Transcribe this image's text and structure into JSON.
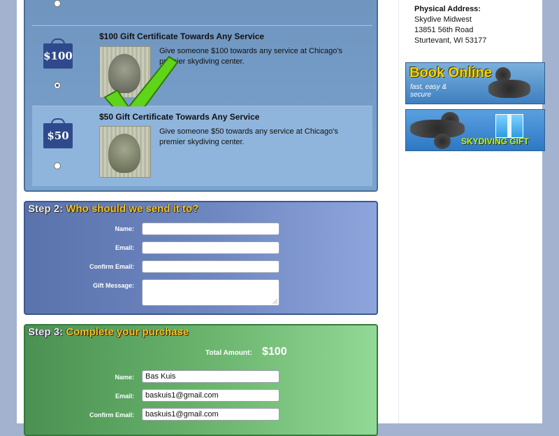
{
  "gifts": [
    {
      "price_tag": "$100",
      "title": "$100 Gift Certificate Towards Any Service",
      "description": "Give someone $100 towards any service at Chicago's premier skydiving center.",
      "selected": true
    },
    {
      "price_tag": "$50",
      "title": "$50 Gift Certificate Towards Any Service",
      "description": "Give someone $50 towards any service at Chicago's premier skydiving center.",
      "selected": false
    }
  ],
  "step2": {
    "number": "Step 2:",
    "title": "Who should we send it to?",
    "name_label": "Name:",
    "email_label": "Email:",
    "confirm_label": "Confirm Email:",
    "message_label": "Gift Message:",
    "name_value": "",
    "email_value": "",
    "confirm_value": "",
    "message_value": ""
  },
  "step3": {
    "number": "Step 3:",
    "title": "Complete your purchase",
    "total_label": "Total Amount:",
    "total_value": "$100",
    "name_label": "Name:",
    "email_label": "Email:",
    "confirm_label": "Confirm Email:",
    "name_value": "Bas Kuis",
    "email_value": "baskuis1@gmail.com",
    "confirm_value": "baskuis1@gmail.com"
  },
  "sidebar": {
    "address_heading": "Physical Address:",
    "address_lines": [
      "Skydive Midwest",
      "13851 56th Road",
      "Sturtevant, WI 53177"
    ],
    "book_title": "Book Online",
    "book_sub_1": "fast, easy &",
    "book_sub_2": "secure",
    "gift_banner_text": "SKYDIVING GIFT"
  },
  "colors": {
    "step_title": "#f7c51e",
    "step2_bg": "#7088c2",
    "step3_bg": "#6cb66f",
    "step1_bg": "#7aa3cd"
  }
}
